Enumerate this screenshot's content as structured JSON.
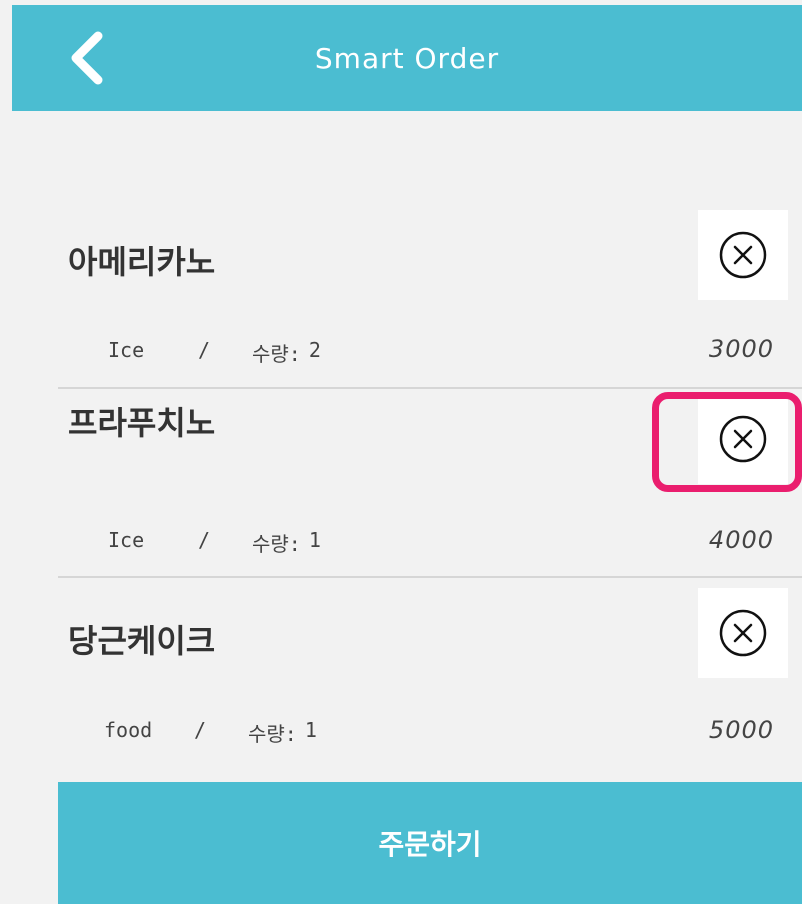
{
  "header": {
    "title": "Smart Order",
    "back_icon": "chevron-left-icon"
  },
  "colors": {
    "accent": "#4bbdd1",
    "highlight": "#ea1e6e",
    "background": "#f2f2f2"
  },
  "items": [
    {
      "name": "아메리카노",
      "type": "Ice",
      "separator": "/",
      "quantity_label": "수량:",
      "quantity": "2",
      "price": "3000",
      "remove_icon": "close-circle-icon"
    },
    {
      "name": "프라푸치노",
      "type": "Ice",
      "separator": "/",
      "quantity_label": "수량:",
      "quantity": "1",
      "price": "4000",
      "remove_icon": "close-circle-icon"
    },
    {
      "name": "당근케이크",
      "type": "food",
      "separator": "/",
      "quantity_label": "수량:",
      "quantity": "1",
      "price": "5000",
      "remove_icon": "close-circle-icon"
    }
  ],
  "order_button": {
    "label": "주문하기"
  }
}
